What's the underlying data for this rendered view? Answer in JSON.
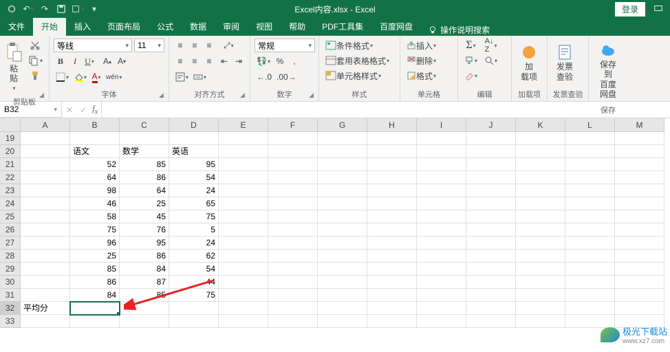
{
  "title": "Excel内容.xlsx - Excel",
  "login": "登录",
  "tabs": {
    "file": "文件",
    "home": "开始",
    "insert": "插入",
    "layout": "页面布局",
    "formulas": "公式",
    "data": "数据",
    "review": "审阅",
    "view": "视图",
    "help": "帮助",
    "pdf": "PDF工具集",
    "baidu": "百度网盘",
    "tellme": "操作说明搜索"
  },
  "ribbon": {
    "clipboard": {
      "label": "剪贴板",
      "paste": "粘贴"
    },
    "font": {
      "label": "字体",
      "name": "等线",
      "size": "11"
    },
    "align": {
      "label": "对齐方式"
    },
    "number": {
      "label": "数字",
      "format": "常规"
    },
    "styles": {
      "label": "样式",
      "cond": "条件格式",
      "table": "套用表格格式",
      "cell": "单元格样式"
    },
    "cells": {
      "label": "单元格",
      "insert": "插入",
      "delete": "删除",
      "format": "格式"
    },
    "editing": {
      "label": "编辑"
    },
    "addins": {
      "label": "加载项",
      "btn": "加\n载项"
    },
    "invoice": {
      "label": "发票查验",
      "btn": "发票\n查验"
    },
    "save": {
      "label": "保存",
      "btn": "保存到\n百度网盘"
    }
  },
  "formulabar": {
    "namebox": "B32"
  },
  "columns": [
    "A",
    "B",
    "C",
    "D",
    "E",
    "F",
    "G",
    "H",
    "I",
    "J",
    "K",
    "L",
    "M"
  ],
  "rows": [
    "19",
    "20",
    "21",
    "22",
    "23",
    "24",
    "25",
    "26",
    "27",
    "28",
    "29",
    "30",
    "31",
    "32",
    "33"
  ],
  "chart_data": {
    "type": "table",
    "headers": [
      "语文",
      "数学",
      "英语"
    ],
    "data": [
      [
        52,
        85,
        95
      ],
      [
        64,
        86,
        54
      ],
      [
        98,
        64,
        24
      ],
      [
        46,
        25,
        65
      ],
      [
        58,
        45,
        75
      ],
      [
        75,
        76,
        5
      ],
      [
        96,
        95,
        24
      ],
      [
        25,
        86,
        62
      ],
      [
        85,
        84,
        54
      ],
      [
        86,
        87,
        44
      ],
      [
        84,
        85,
        75
      ]
    ],
    "row_label": "平均分"
  },
  "selected_cell": "B32",
  "watermark": {
    "name": "极光下载站",
    "url": "www.xz7.com"
  }
}
